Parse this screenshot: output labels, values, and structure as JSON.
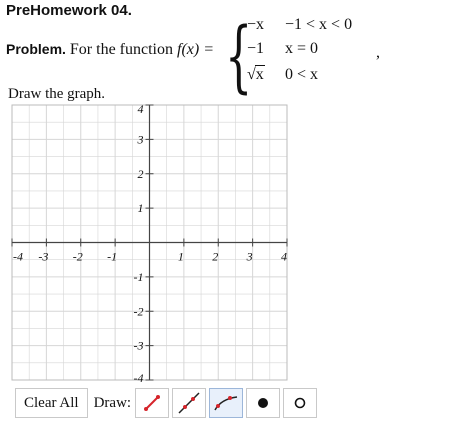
{
  "header": {
    "title": "PreHomework 04."
  },
  "problem": {
    "label": "Problem.",
    "text": "For the function",
    "function_name": "f(x) =",
    "pieces": [
      {
        "expr": "−x",
        "cond": "−1 < x < 0"
      },
      {
        "expr": "−1",
        "cond": "x = 0"
      },
      {
        "expr": "x",
        "expr_prefix": "√",
        "cond": "0 < x"
      }
    ],
    "trailing": ","
  },
  "prompt": {
    "text": "Draw the graph."
  },
  "graph": {
    "x_range": [
      -4,
      4
    ],
    "y_range": [
      -4,
      4
    ],
    "minor_step": 0.5,
    "x_tick_labels": [
      "-4",
      "-3",
      "-2",
      "-1",
      "1",
      "2",
      "3",
      "4"
    ],
    "y_tick_labels": [
      "4",
      "3",
      "2",
      "1",
      "-1",
      "-2",
      "-3",
      "-4"
    ],
    "grid_color": "#d6d6d6",
    "axis_color": "#444444"
  },
  "toolbar": {
    "clear_label": "Clear All",
    "draw_label": "Draw:",
    "tools": [
      {
        "name": "line-segment-tool",
        "icon": "segment-icon",
        "active": false
      },
      {
        "name": "line-tool",
        "icon": "line-icon",
        "active": false
      },
      {
        "name": "curve-tool",
        "icon": "curve-icon",
        "active": true
      },
      {
        "name": "closed-dot-tool",
        "icon": "filled-dot-icon",
        "active": false
      },
      {
        "name": "open-dot-tool",
        "icon": "open-dot-icon",
        "active": false
      }
    ],
    "accent_color": "#d6252c"
  }
}
